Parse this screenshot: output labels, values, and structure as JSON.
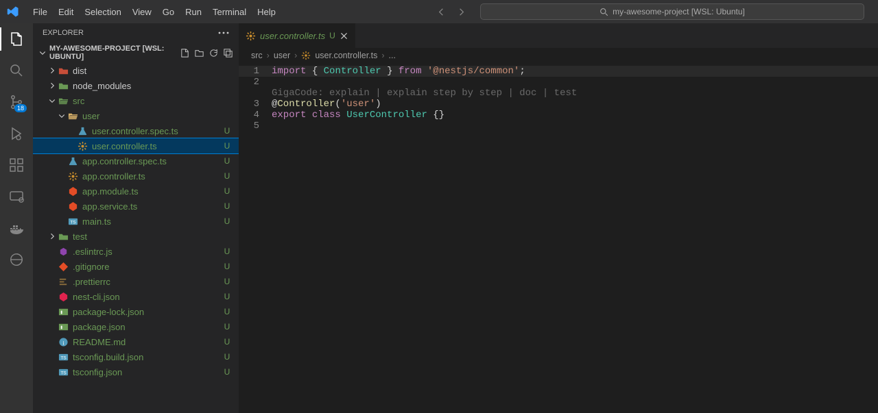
{
  "menu": [
    "File",
    "Edit",
    "Selection",
    "View",
    "Go",
    "Run",
    "Terminal",
    "Help"
  ],
  "search": {
    "text": "my-awesome-project [WSL: Ubuntu]"
  },
  "activity": {
    "scmBadge": "18"
  },
  "sidebar": {
    "title": "EXPLORER",
    "projectTitle": "MY-AWESOME-PROJECT [WSL: UBUNTU]"
  },
  "tree": [
    {
      "indent": 1,
      "chev": "right",
      "iconColor": "#c74e39",
      "iconType": "folder",
      "name": "dist",
      "git": ""
    },
    {
      "indent": 1,
      "chev": "right",
      "iconColor": "#6a9955",
      "iconType": "folder",
      "name": "node_modules",
      "git": ""
    },
    {
      "indent": 1,
      "chev": "down",
      "iconColor": "#6a9955",
      "iconType": "folder-open",
      "name": "src",
      "git": "dot",
      "nameColor": "#6a9955"
    },
    {
      "indent": 2,
      "chev": "down",
      "iconColor": "#dbb36b",
      "iconType": "folder-open",
      "name": "user",
      "git": "dot",
      "nameColor": "#6a9955"
    },
    {
      "indent": 3,
      "chev": "",
      "iconColor": "#519aba",
      "iconType": "flask",
      "name": "user.controller.spec.ts",
      "git": "U",
      "nameColor": "#6a9955"
    },
    {
      "indent": 3,
      "chev": "",
      "iconColor": "#cc8f2c",
      "iconType": "gear",
      "name": "user.controller.ts",
      "git": "U",
      "nameColor": "#6a9955",
      "selected": true
    },
    {
      "indent": 2,
      "chev": "",
      "iconColor": "#519aba",
      "iconType": "flask",
      "name": "app.controller.spec.ts",
      "git": "U",
      "nameColor": "#6a9955"
    },
    {
      "indent": 2,
      "chev": "",
      "iconColor": "#cc8f2c",
      "iconType": "gear",
      "name": "app.controller.ts",
      "git": "U",
      "nameColor": "#6a9955"
    },
    {
      "indent": 2,
      "chev": "",
      "iconColor": "#e34c26",
      "iconType": "nest",
      "name": "app.module.ts",
      "git": "U",
      "nameColor": "#6a9955"
    },
    {
      "indent": 2,
      "chev": "",
      "iconColor": "#e34c26",
      "iconType": "nest",
      "name": "app.service.ts",
      "git": "U",
      "nameColor": "#6a9955"
    },
    {
      "indent": 2,
      "chev": "",
      "iconColor": "#519aba",
      "iconType": "ts",
      "name": "main.ts",
      "git": "U",
      "nameColor": "#6a9955"
    },
    {
      "indent": 1,
      "chev": "right",
      "iconColor": "#6a9955",
      "iconType": "folder",
      "name": "test",
      "git": "dot",
      "nameColor": "#6a9955"
    },
    {
      "indent": 1,
      "chev": "",
      "iconColor": "#8e44ad",
      "iconType": "eslint",
      "name": ".eslintrc.js",
      "git": "U",
      "nameColor": "#6a9955"
    },
    {
      "indent": 1,
      "chev": "",
      "iconColor": "#e44d26",
      "iconType": "git",
      "name": ".gitignore",
      "git": "U",
      "nameColor": "#6a9955"
    },
    {
      "indent": 1,
      "chev": "",
      "iconColor": "#8a6d3b",
      "iconType": "prettier",
      "name": ".prettierrc",
      "git": "U",
      "nameColor": "#6a9955"
    },
    {
      "indent": 1,
      "chev": "",
      "iconColor": "#e0234e",
      "iconType": "nest",
      "name": "nest-cli.json",
      "git": "U",
      "nameColor": "#6a9955"
    },
    {
      "indent": 1,
      "chev": "",
      "iconColor": "#6a9955",
      "iconType": "npm",
      "name": "package-lock.json",
      "git": "U",
      "nameColor": "#6a9955"
    },
    {
      "indent": 1,
      "chev": "",
      "iconColor": "#6a9955",
      "iconType": "npm",
      "name": "package.json",
      "git": "U",
      "nameColor": "#6a9955"
    },
    {
      "indent": 1,
      "chev": "",
      "iconColor": "#519aba",
      "iconType": "info",
      "name": "README.md",
      "git": "U",
      "nameColor": "#6a9955"
    },
    {
      "indent": 1,
      "chev": "",
      "iconColor": "#519aba",
      "iconType": "ts",
      "name": "tsconfig.build.json",
      "git": "U",
      "nameColor": "#6a9955"
    },
    {
      "indent": 1,
      "chev": "",
      "iconColor": "#519aba",
      "iconType": "ts",
      "name": "tsconfig.json",
      "git": "U",
      "nameColor": "#6a9955"
    }
  ],
  "tab": {
    "label": "user.controller.ts",
    "badge": "U"
  },
  "breadcrumb": [
    "src",
    "user",
    "user.controller.ts",
    "..."
  ],
  "code": {
    "hint": "GigaCode: explain | explain step by step | doc | test",
    "line1": {
      "import": "import",
      "lb": "{",
      "Controller": "Controller",
      "rb": "}",
      "from": "from",
      "str": "'@nestjs/common'",
      "semi": ";"
    },
    "line3": {
      "at": "@",
      "dec": "Controller",
      "open": "(",
      "str": "'user'",
      "close": ")"
    },
    "line4": {
      "export": "export",
      "class": "class",
      "name": "UserController",
      "body": "{}"
    }
  }
}
